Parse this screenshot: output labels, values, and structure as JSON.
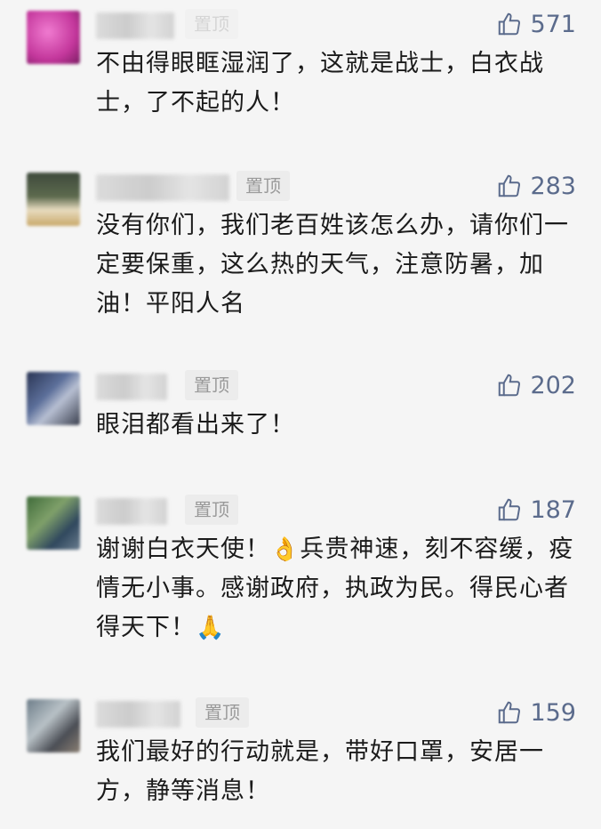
{
  "comments": [
    {
      "pin_label": "置顶",
      "likes": "571",
      "text": "不由得眼眶湿润了，这就是战士，白衣战士，了不起的人！"
    },
    {
      "pin_label": "置顶",
      "likes": "283",
      "text": "没有你们，我们老百姓该怎么办，请你们一定要保重，这么热的天气，注意防暑，加油！平阳人名"
    },
    {
      "pin_label": "置顶",
      "likes": "202",
      "text": "眼泪都看出来了！"
    },
    {
      "pin_label": "置顶",
      "likes": "187",
      "text_a": "谢谢白衣天使！",
      "emoji_a": "👌",
      "text_b": "兵贵神速，刻不容缓，疫情无小事。感谢政府，执政为民。得民心者得天下！",
      "emoji_b": "🙏"
    },
    {
      "pin_label": "置顶",
      "likes": "159",
      "text": "我们最好的行动就是，带好口罩，安居一方，静等消息！"
    }
  ],
  "icons": {
    "like": "thumbs-up-icon"
  },
  "colors": {
    "like": "#5b6b8c",
    "pin_bg": "#ececec",
    "background": "#f5f5f5"
  }
}
